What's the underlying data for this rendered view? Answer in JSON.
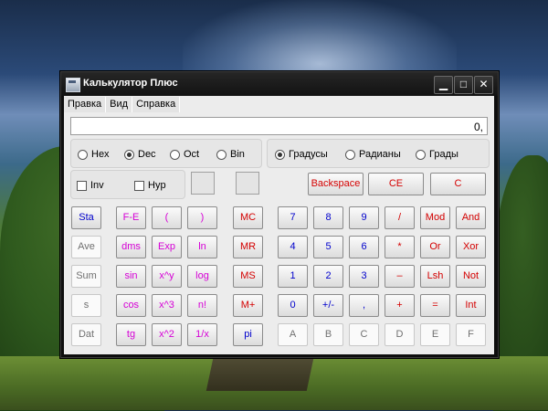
{
  "window": {
    "title": "Калькулятор Плюс",
    "min": "▁",
    "max": "□",
    "close": "✕"
  },
  "menu": [
    "Правка",
    "Вид",
    "Справка"
  ],
  "display": "0,",
  "bases": [
    {
      "label": "Hex",
      "checked": false
    },
    {
      "label": "Dec",
      "checked": true
    },
    {
      "label": "Oct",
      "checked": false
    },
    {
      "label": "Bin",
      "checked": false
    }
  ],
  "angles": [
    {
      "label": "Градусы",
      "checked": true
    },
    {
      "label": "Радианы",
      "checked": false
    },
    {
      "label": "Грады",
      "checked": false
    }
  ],
  "checks": [
    {
      "label": "Inv",
      "checked": false
    },
    {
      "label": "Hyp",
      "checked": false
    }
  ],
  "edit_buttons": [
    "Backspace",
    "CE",
    "C"
  ],
  "stat_col": [
    "Sta",
    "Ave",
    "Sum",
    "s",
    "Dat"
  ],
  "sci_col1": [
    "F-E",
    "dms",
    "sin",
    "cos",
    "tg"
  ],
  "sci_col2": [
    "(",
    "Exp",
    "x^y",
    "x^3",
    "x^2"
  ],
  "sci_col3": [
    ")",
    "ln",
    "log",
    "n!",
    "1/x"
  ],
  "mem_col": [
    "MC",
    "MR",
    "MS",
    "M+",
    "pi"
  ],
  "grid": [
    [
      "7",
      "8",
      "9",
      "/",
      "Mod",
      "And"
    ],
    [
      "4",
      "5",
      "6",
      "*",
      "Or",
      "Xor"
    ],
    [
      "1",
      "2",
      "3",
      "–",
      "Lsh",
      "Not"
    ],
    [
      "0",
      "+/-",
      ",",
      "+",
      "=",
      "Int"
    ],
    [
      "A",
      "B",
      "C",
      "D",
      "E",
      "F"
    ]
  ]
}
